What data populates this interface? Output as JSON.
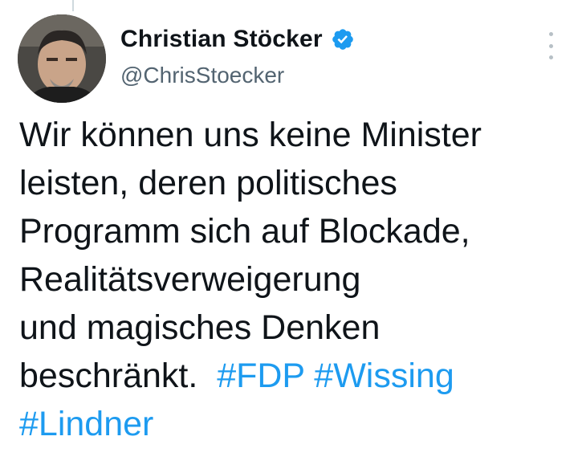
{
  "author": {
    "display_name": "Christian Stöcker",
    "handle": "@ChrisStoecker",
    "verified": true,
    "avatar_icon": "profile-photo"
  },
  "tweet": {
    "lines": [
      "Wir können uns keine Minister",
      "leisten, deren politisches",
      "Programm sich auf Blockade,",
      "Realitätsverweigerung",
      "und magisches Denken",
      "beschränkt."
    ],
    "hashtags": [
      "#FDP",
      "#Wissing",
      "#Lindner"
    ]
  },
  "colors": {
    "text": "#0f1419",
    "secondary": "#536471",
    "accent": "#1d9bf0"
  }
}
